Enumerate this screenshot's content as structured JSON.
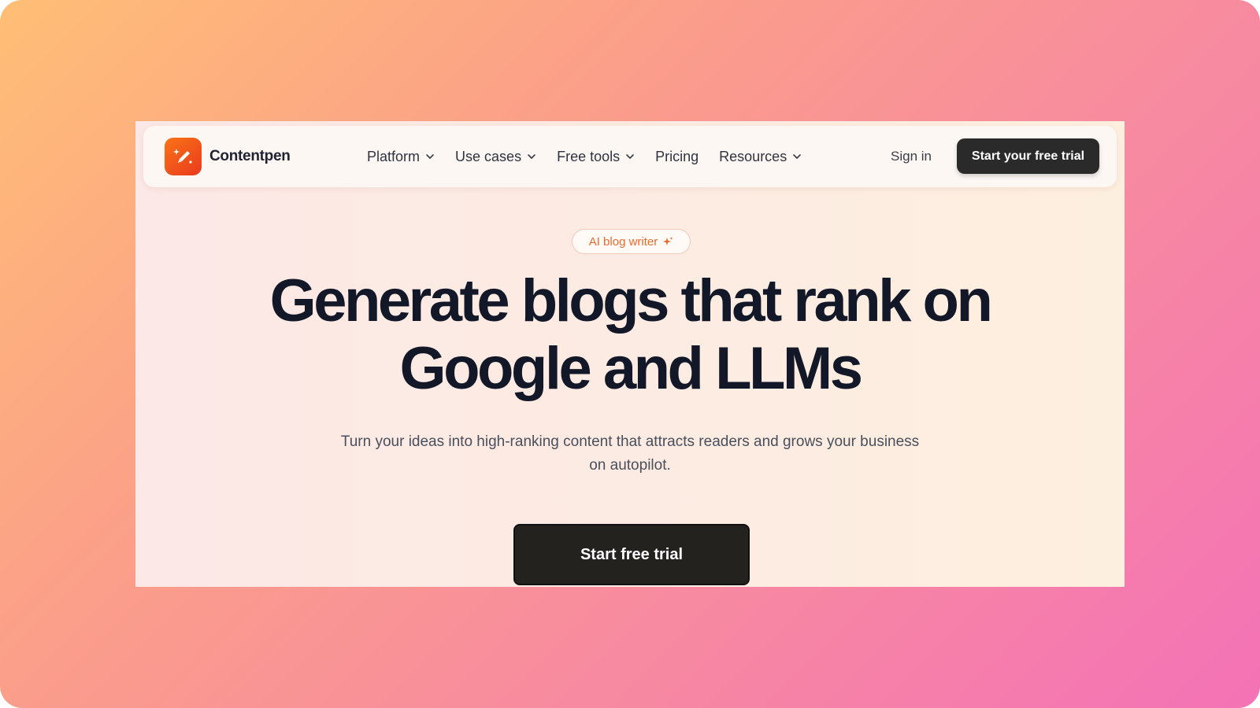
{
  "brand": {
    "name": "Contentpen",
    "accent": "#ea3a1e"
  },
  "nav": {
    "items": [
      {
        "label": "Platform",
        "has_dropdown": true
      },
      {
        "label": "Use cases",
        "has_dropdown": true
      },
      {
        "label": "Free tools",
        "has_dropdown": true
      },
      {
        "label": "Pricing",
        "has_dropdown": false
      },
      {
        "label": "Resources",
        "has_dropdown": true
      }
    ],
    "sign_in": "Sign in",
    "cta": "Start your free trial"
  },
  "hero": {
    "badge": "AI blog writer",
    "badge_icon": "sparkle-icon",
    "headline_line1": "Generate blogs that rank on",
    "headline_line2": "Google and LLMs",
    "subtitle_line1": "Turn your ideas into high-ranking content that attracts readers and grows your business",
    "subtitle_line2": "on autopilot.",
    "cta": "Start free trial"
  }
}
